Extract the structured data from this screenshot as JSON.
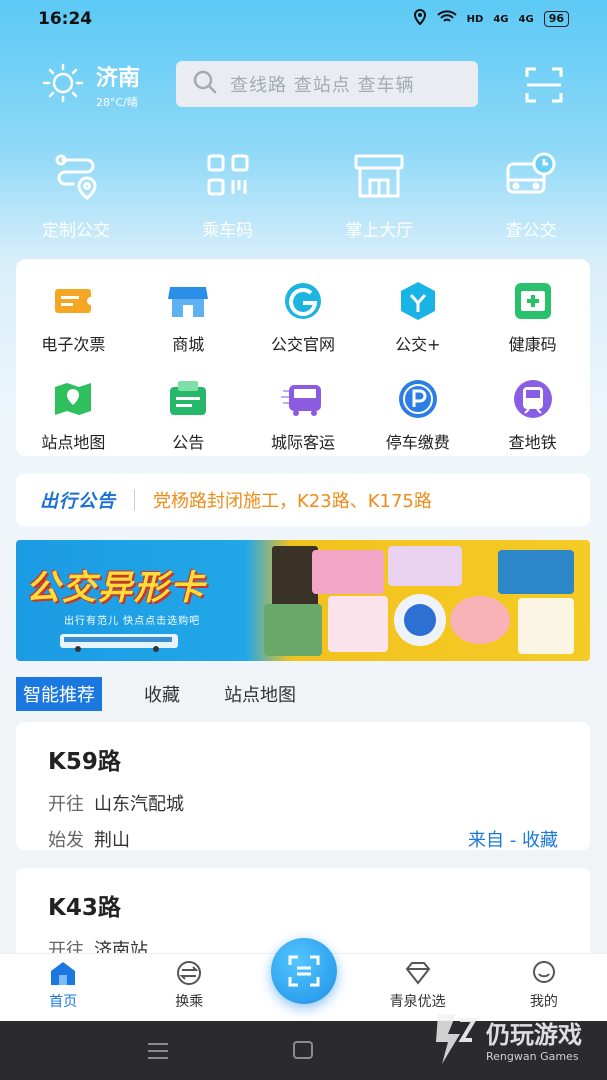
{
  "status_bar": {
    "time": "16:24",
    "hd": "HD",
    "signal1": "4G",
    "signal2": "4G",
    "battery": "96"
  },
  "header": {
    "city": "济南",
    "weather": "28°C/晴",
    "search_placeholder": "查线路 查站点 查车辆"
  },
  "top_nav": [
    {
      "label": "定制公交",
      "icon": "custom-bus-icon"
    },
    {
      "label": "乘车码",
      "icon": "qr-code-icon"
    },
    {
      "label": "掌上大厅",
      "icon": "hall-icon"
    },
    {
      "label": "查公交",
      "icon": "bus-clock-icon"
    }
  ],
  "services": [
    {
      "label": "电子次票",
      "icon": "ticket-icon",
      "color": "#f5a623"
    },
    {
      "label": "商城",
      "icon": "shop-icon",
      "color": "#2b8fe8"
    },
    {
      "label": "公交官网",
      "icon": "website-icon",
      "color": "#1cb5e0"
    },
    {
      "label": "公交+",
      "icon": "bus-plus-icon",
      "color": "#19b4e6"
    },
    {
      "label": "健康码",
      "icon": "health-code-icon",
      "color": "#29c16b"
    },
    {
      "label": "站点地图",
      "icon": "map-icon",
      "color": "#2fbf5d"
    },
    {
      "label": "公告",
      "icon": "notice-icon",
      "color": "#25b86a"
    },
    {
      "label": "城际客运",
      "icon": "intercity-bus-icon",
      "color": "#8b5be0"
    },
    {
      "label": "停车缴费",
      "icon": "parking-icon",
      "color": "#2d7de6"
    },
    {
      "label": "查地铁",
      "icon": "subway-icon",
      "color": "#8a5ee4"
    }
  ],
  "notice": {
    "tag": "出行公告",
    "text": "党杨路封闭施工，K23路、K175路"
  },
  "banner": {
    "title": "公交异形卡",
    "subtitle": "出行有范儿 快点点击选购吧"
  },
  "tabs": [
    "智能推荐",
    "收藏",
    "站点地图"
  ],
  "routes": [
    {
      "name": "K59路",
      "to_key": "开往",
      "to": "山东汽配城",
      "from_key": "始发",
      "from": "荆山",
      "source": "来自 - 收藏"
    },
    {
      "name": "K43路",
      "to_key": "开往",
      "to": "济南站"
    }
  ],
  "bottom_bar": [
    {
      "label": "首页",
      "icon": "home-icon",
      "active": true
    },
    {
      "label": "换乘",
      "icon": "transfer-icon",
      "active": false
    },
    {
      "label": "青泉优选",
      "icon": "diamond-icon",
      "active": false
    },
    {
      "label": "我的",
      "icon": "profile-icon",
      "active": false
    }
  ],
  "watermark": {
    "cn": "仍玩游戏",
    "en": "Rengwan Games"
  },
  "colors": {
    "accent": "#1a78e0",
    "notice_text": "#f08c1a"
  }
}
